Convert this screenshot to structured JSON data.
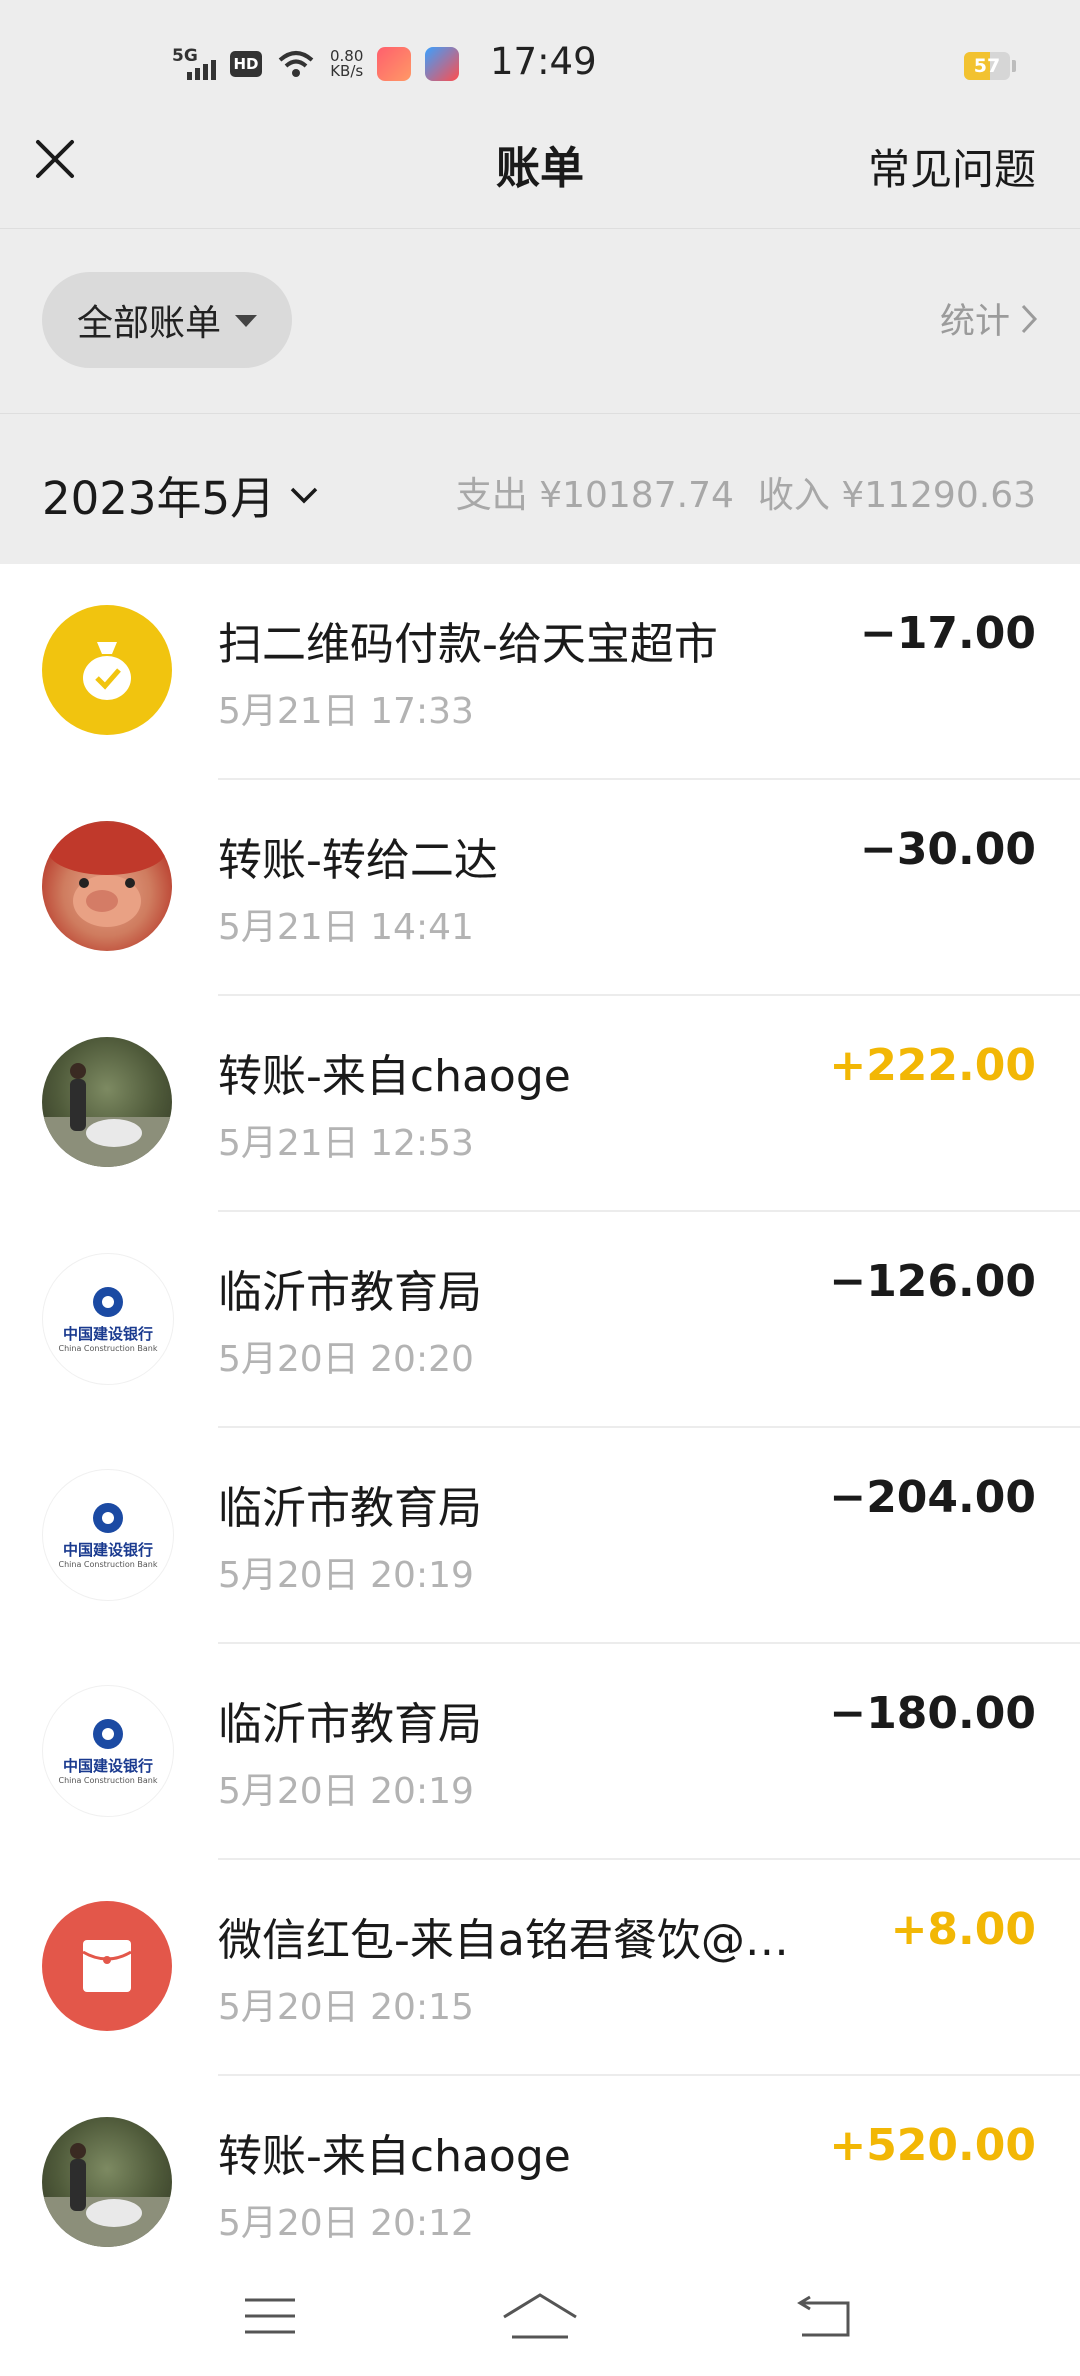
{
  "status_bar": {
    "network": "5G",
    "hd_badge": "HD",
    "speed_value": "0.80",
    "speed_unit": "KB/s",
    "time": "17:49",
    "battery": "57",
    "battery_fraction": 0.57
  },
  "header": {
    "title": "账单",
    "faq_label": "常见问题"
  },
  "filter": {
    "all_bills_label": "全部账单",
    "stats_label": "统计"
  },
  "month_header": {
    "month": "2023年5月",
    "expense_summary": "支出 ¥10187.74",
    "income_summary": "收入 ¥11290.63"
  },
  "transactions": [
    {
      "title": "扫二维码付款-给天宝超市",
      "time": "5月21日 17:33",
      "amount": "−17.00",
      "direction": "out",
      "icon": "money-bag-icon"
    },
    {
      "title": "转账-转给二达",
      "time": "5月21日 14:41",
      "amount": "−30.00",
      "direction": "out",
      "icon": "pig-avatar"
    },
    {
      "title": "转账-来自chaoge",
      "time": "5月21日 12:53",
      "amount": "+222.00",
      "direction": "in",
      "icon": "photo-avatar"
    },
    {
      "title": "临沂市教育局",
      "time": "5月20日 20:20",
      "amount": "−126.00",
      "direction": "out",
      "icon": "ccb-bank-logo"
    },
    {
      "title": "临沂市教育局",
      "time": "5月20日 20:19",
      "amount": "−204.00",
      "direction": "out",
      "icon": "ccb-bank-logo"
    },
    {
      "title": "临沂市教育局",
      "time": "5月20日 20:19",
      "amount": "−180.00",
      "direction": "out",
      "icon": "ccb-bank-logo"
    },
    {
      "title": "微信红包-来自a铭君餐饮@…",
      "time": "5月20日 20:15",
      "amount": "+8.00",
      "direction": "in",
      "icon": "red-packet-icon"
    },
    {
      "title": "转账-来自chaoge",
      "time": "5月20日 20:12",
      "amount": "+520.00",
      "direction": "in",
      "icon": "photo-avatar"
    }
  ],
  "bank_logo": {
    "name_cn": "中国建设银行",
    "name_en": "China Construction Bank"
  },
  "colors": {
    "income": "#f2b705",
    "expense": "#1a1a1a",
    "page_bg": "#ededed",
    "list_bg": "#ffffff",
    "secondary_text": "#b3b3b3"
  },
  "nav_bar": {
    "icons": [
      "menu-icon",
      "home-icon",
      "back-icon"
    ]
  }
}
